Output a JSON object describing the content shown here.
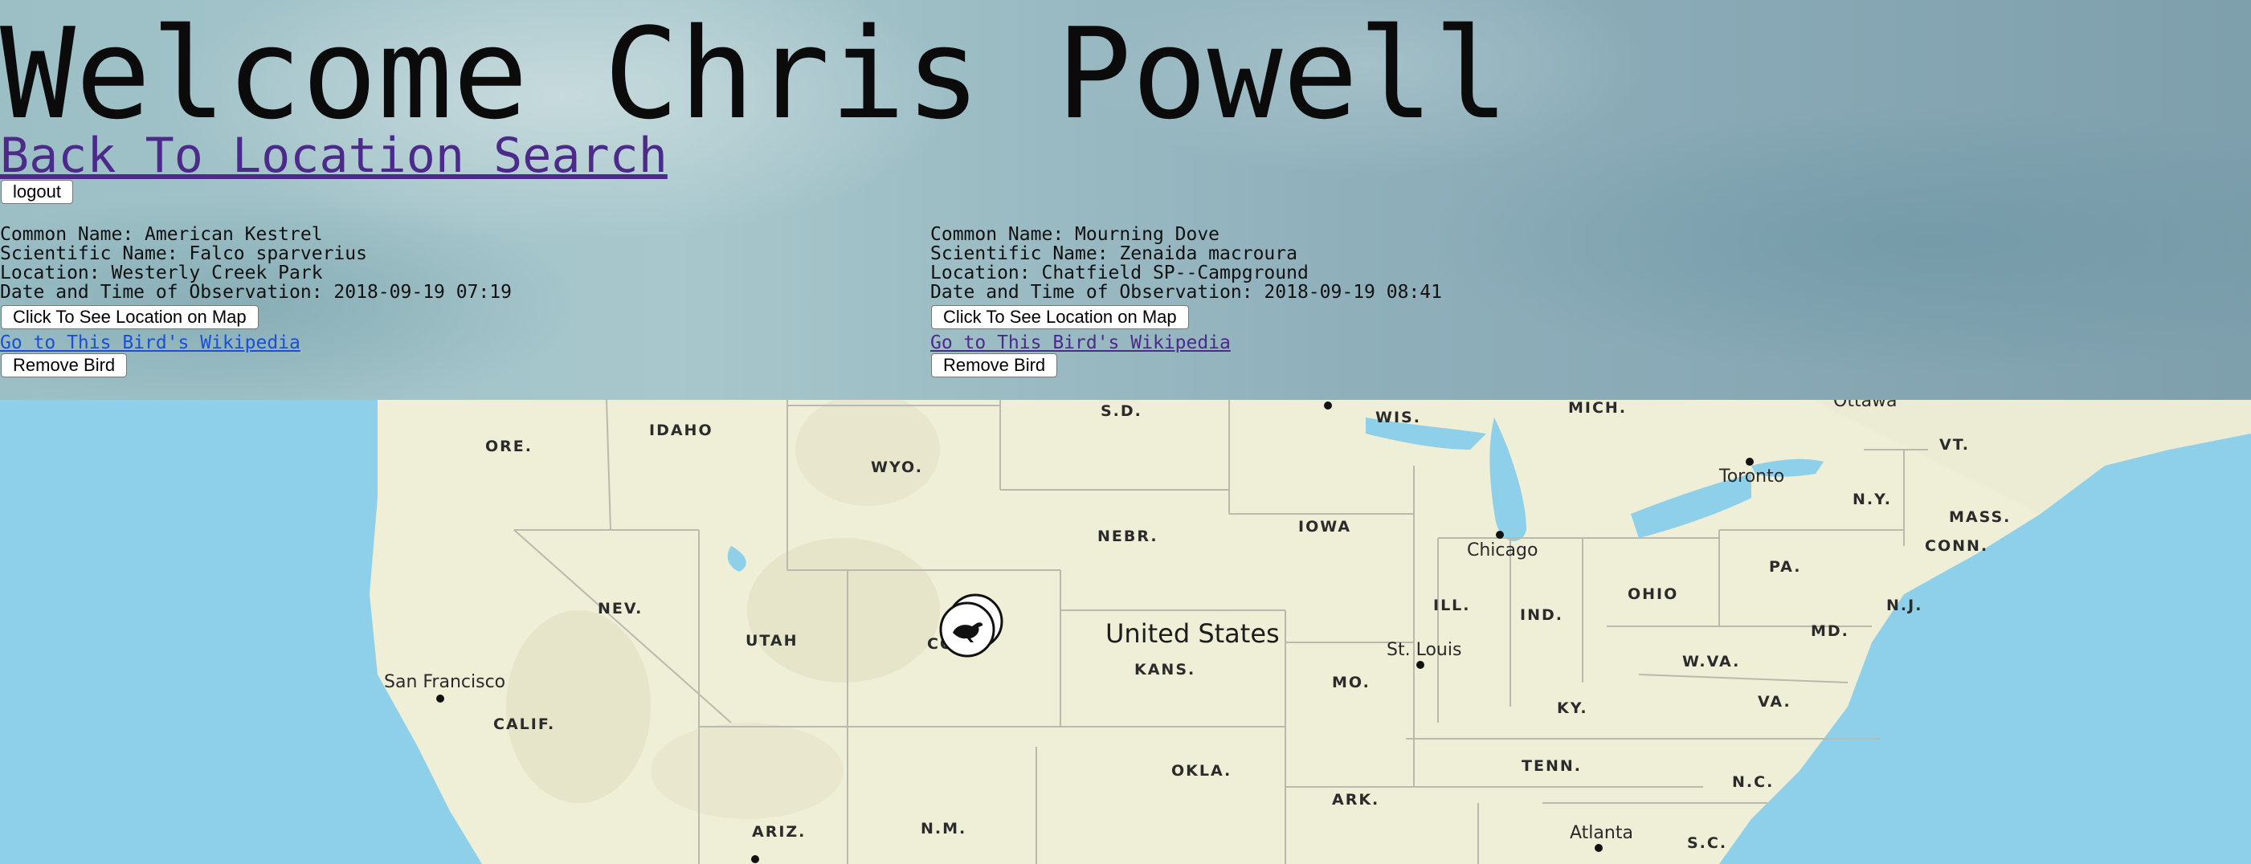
{
  "header": {
    "welcome": "Welcome Chris Powell",
    "back_link": "Back To Location Search",
    "logout_label": "logout"
  },
  "birds": [
    {
      "common": "Common Name: American Kestrel",
      "scientific": "Scientific Name: Falco sparverius",
      "location": "Location: Westerly Creek Park",
      "datetime": "Date and Time of Observation: 2018-09-19 07:19",
      "map_button": "Click To See Location on Map",
      "wiki_link": "Go to This Bird's Wikipedia",
      "remove_button": "Remove Bird"
    },
    {
      "common": "Common Name: Mourning Dove",
      "scientific": "Scientific Name: Zenaida macroura",
      "location": "Location: Chatfield SP--Campground",
      "datetime": "Date and Time of Observation: 2018-09-19 08:41",
      "map_button": "Click To See Location on Map",
      "wiki_link": "Go to This Bird's Wikipedia",
      "remove_button": "Remove Bird"
    }
  ],
  "map": {
    "country": "United States",
    "states": [
      "ORE.",
      "IDAHO",
      "WYO.",
      "S.D.",
      "WIS.",
      "MICH.",
      "VT.",
      "NEBR.",
      "IOWA",
      "N.Y.",
      "MASS.",
      "CONN.",
      "PA.",
      "N.J.",
      "NEV.",
      "UTAH",
      "CO",
      "ILL.",
      "IND.",
      "OHIO",
      "MD.",
      "KANS.",
      "MO.",
      "W.VA.",
      "VA.",
      "KY.",
      "CALIF.",
      "TENN.",
      "N.C.",
      "OKLA.",
      "ARK.",
      "ARIZ.",
      "N.M.",
      "S.C."
    ],
    "cities": [
      "Ottawa",
      "Toronto",
      "Chicago",
      "St. Louis",
      "San Francisco",
      "Atlanta"
    ],
    "marker_icon": "bird-icon",
    "colors": {
      "land": "#efeed6",
      "water": "#8ed0ea",
      "border": "#b9b9ae"
    }
  }
}
